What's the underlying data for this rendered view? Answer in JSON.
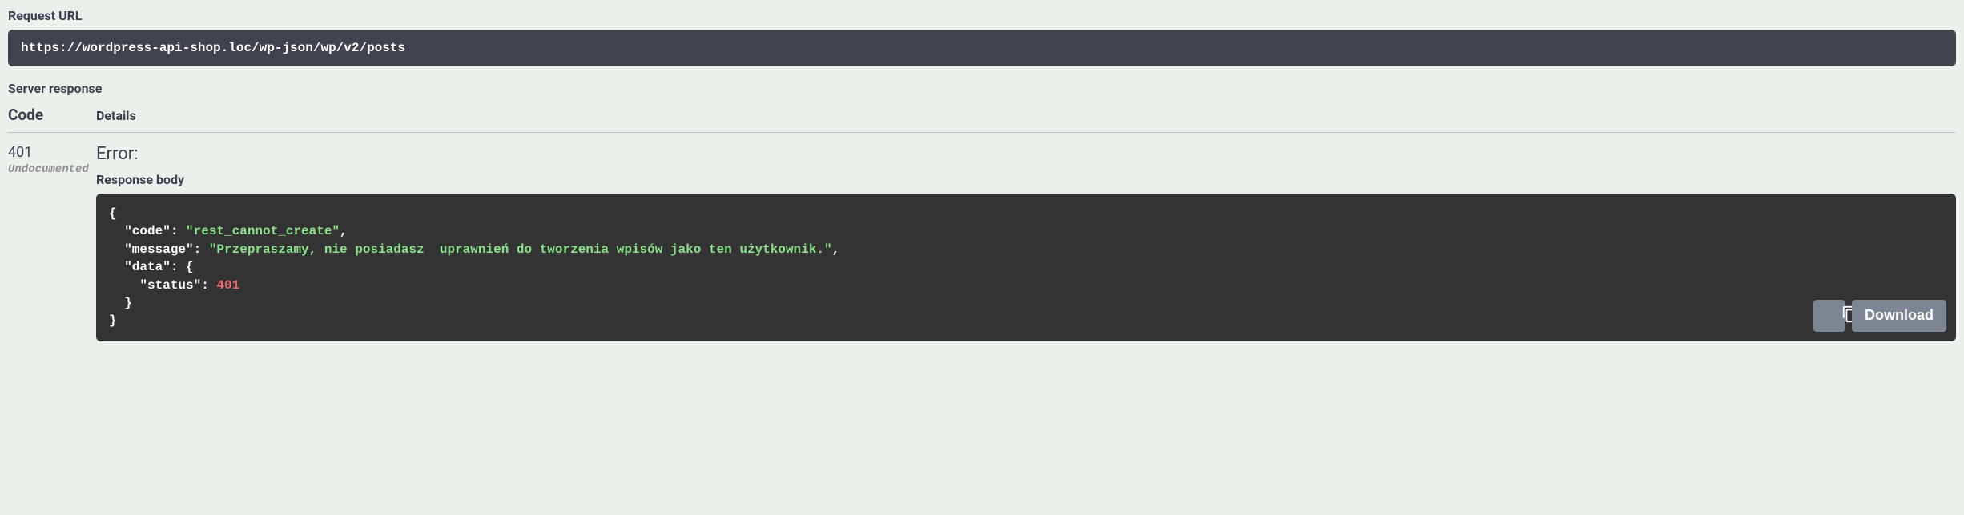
{
  "request": {
    "url_label": "Request URL",
    "url": "https://wordpress-api-shop.loc/wp-json/wp/v2/posts"
  },
  "server_response": {
    "label": "Server response",
    "code_header": "Code",
    "details_header": "Details",
    "code": "401",
    "undocumented": "Undocumented",
    "error_label": "Error:",
    "response_body_label": "Response body",
    "download_label": "Download",
    "body": {
      "code_key": "\"code\"",
      "code_val": "\"rest_cannot_create\"",
      "message_key": "\"message\"",
      "message_val": "\"Przepraszamy, nie posiadasz  uprawnień do tworzenia wpisów jako ten użytkownik.\"",
      "data_key": "\"data\"",
      "status_key": "\"status\"",
      "status_val": "401"
    }
  }
}
